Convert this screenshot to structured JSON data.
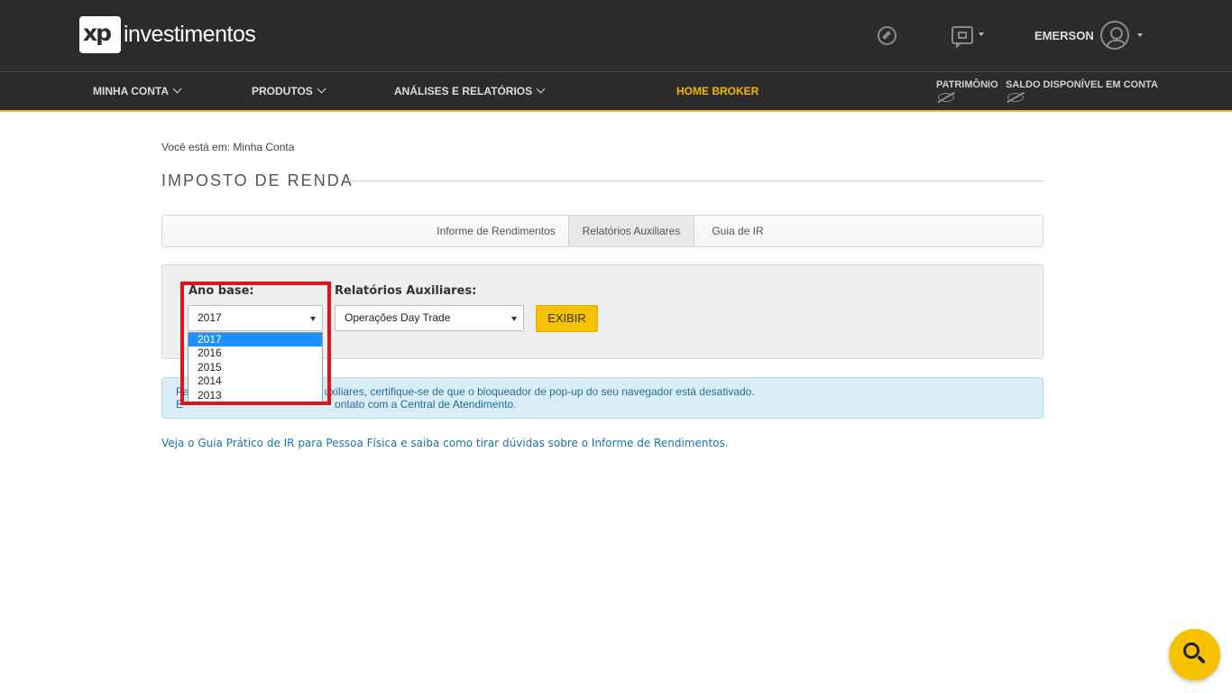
{
  "header": {
    "logo_mark": "xp",
    "logo_text": "investimentos",
    "user_name": "EMERSON",
    "icons": [
      "compass-icon",
      "chat-icon",
      "user-avatar-icon"
    ]
  },
  "nav": {
    "items": [
      {
        "label": "MINHA CONTA"
      },
      {
        "label": "PRODUTOS"
      },
      {
        "label": "ANÁLISES E RELATÓRIOS"
      }
    ],
    "home_broker": "HOME BROKER",
    "patrimonio": "PATRIMÔNIO",
    "saldo": "SALDO DISPONÍVEL EM CONTA",
    "accent_color": "#f7b500"
  },
  "breadcrumb": "Você está em: Minha Conta",
  "page_title": "IMPOSTO DE RENDA",
  "tabs": [
    {
      "label": "Informe de Rendimentos"
    },
    {
      "label": "Relatórios Auxiliares"
    },
    {
      "label": "Guia de IR"
    }
  ],
  "form": {
    "ano_base_label": "Ano base:",
    "ano_base_value": "2017",
    "ano_base_options": [
      "2017",
      "2016",
      "2015",
      "2014",
      "2013"
    ],
    "relatorios_label": "Relatórios Auxiliares:",
    "relatorios_value": "Operações Day Trade",
    "exibir_label": "EXIBIR"
  },
  "info": {
    "line1_prefix": "Pa",
    "line1_text": "uxiliares, certifique-se de que o bloqueador de pop-up do seu navegador está desativado.",
    "line2_prefix": "E",
    "line2_text": "ontato com a ",
    "line2_link": "Central de Atendimento",
    "line2_suffix": "."
  },
  "guide_link": "Veja o Guia Prático de IR para Pessoa Física e saiba como tirar dúvidas sobre o Informe de Rendimentos."
}
